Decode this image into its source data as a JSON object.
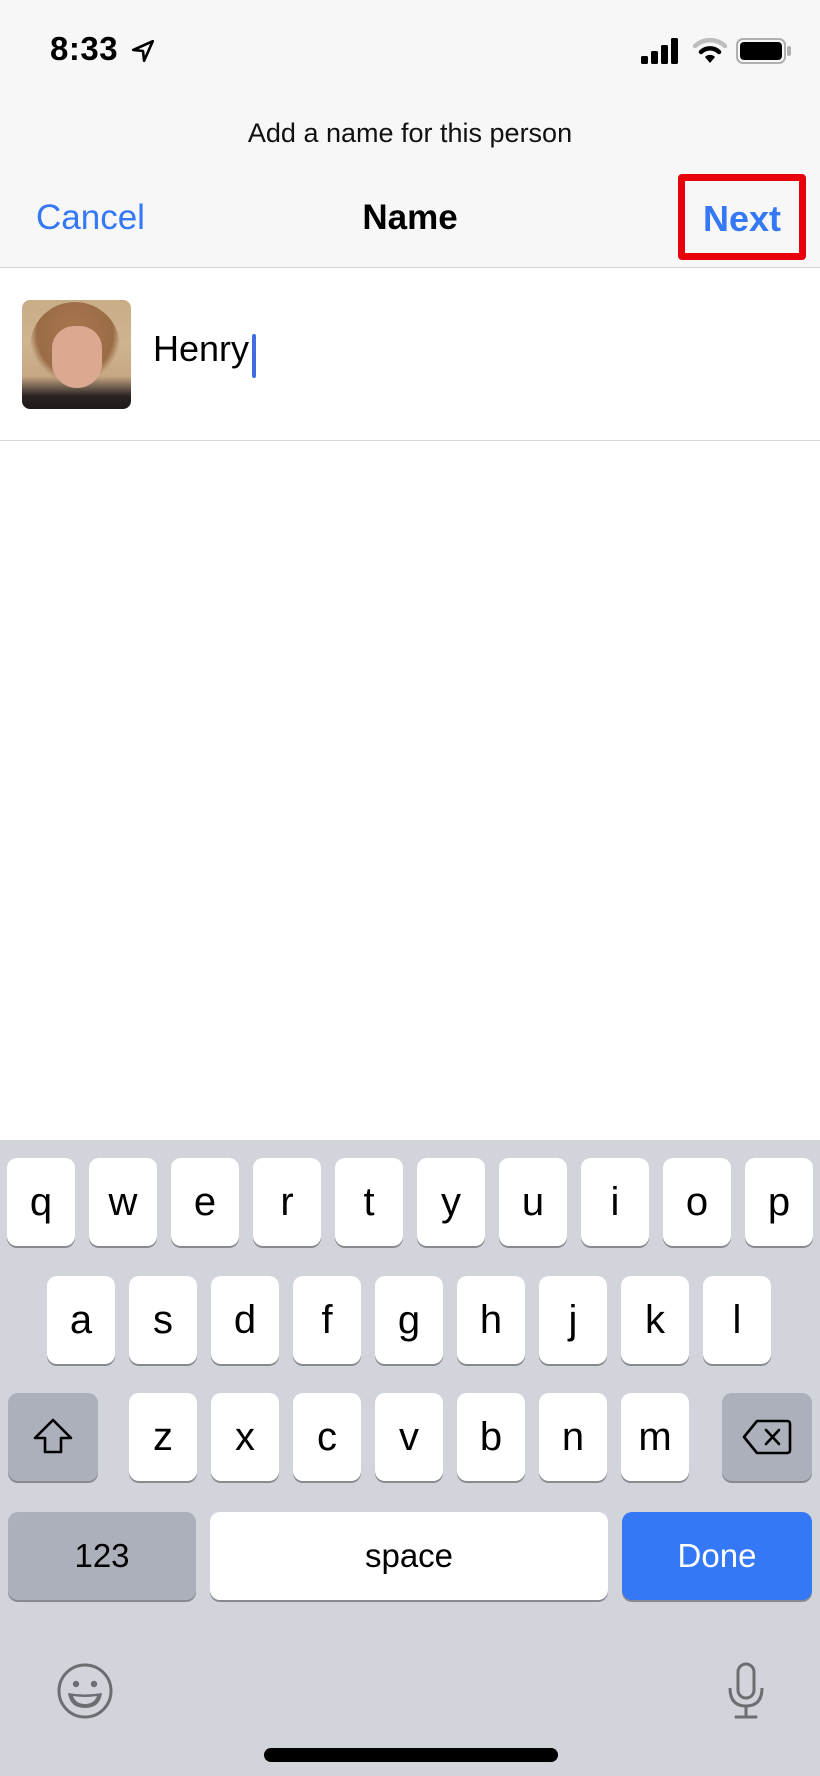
{
  "status_bar": {
    "time": "8:33",
    "icons": [
      "location-arrow-icon",
      "cellular-signal-icon",
      "wifi-icon",
      "battery-icon"
    ]
  },
  "nav": {
    "prompt": "Add a name for this person",
    "cancel_label": "Cancel",
    "title": "Name",
    "next_label": "Next",
    "highlight_color": "#e8000b",
    "accent_color": "#3478f6"
  },
  "person": {
    "name_value": "Henry",
    "photo": "blurred-face-photo"
  },
  "keyboard": {
    "row1": [
      "q",
      "w",
      "e",
      "r",
      "t",
      "y",
      "u",
      "i",
      "o",
      "p"
    ],
    "row2": [
      "a",
      "s",
      "d",
      "f",
      "g",
      "h",
      "j",
      "k",
      "l"
    ],
    "row3": [
      "z",
      "x",
      "c",
      "v",
      "b",
      "n",
      "m"
    ],
    "shift_icon": "shift-icon",
    "delete_icon": "delete-icon",
    "numbers_label": "123",
    "space_label": "space",
    "done_label": "Done",
    "emoji_icon": "emoji-icon",
    "mic_icon": "microphone-icon"
  }
}
